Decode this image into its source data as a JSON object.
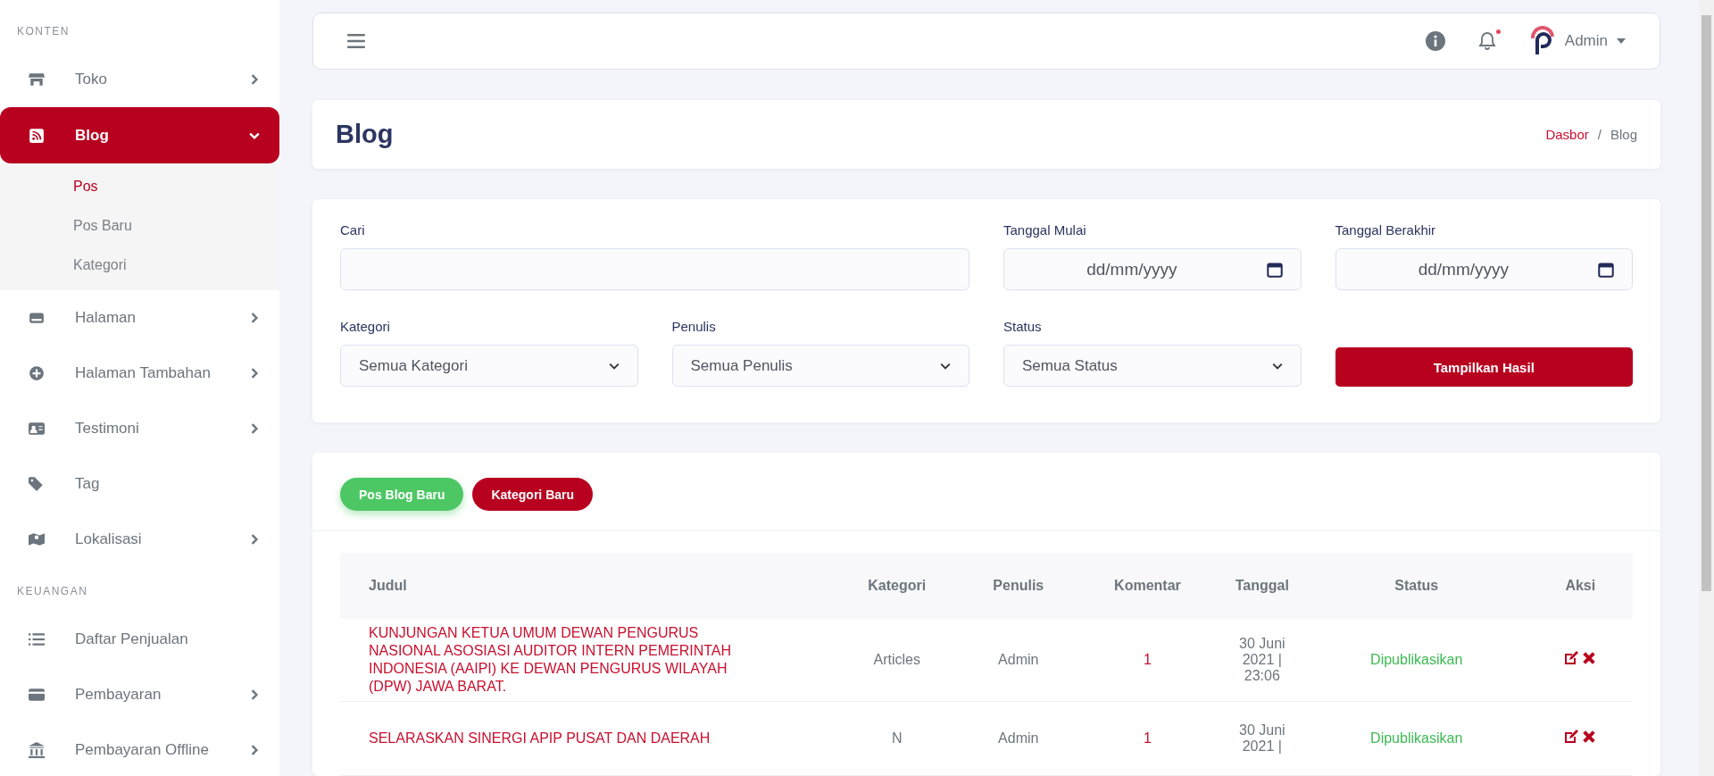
{
  "sidebar": {
    "sections": [
      {
        "heading": "KONTEN",
        "items": [
          {
            "label": "Toko",
            "kind": "group",
            "expanded": false,
            "selected": false
          },
          {
            "label": "Blog",
            "kind": "group",
            "expanded": true,
            "selected": true,
            "children": [
              {
                "label": "Pos",
                "selected": true
              },
              {
                "label": "Pos Baru",
                "selected": false
              },
              {
                "label": "Kategori",
                "selected": false
              }
            ]
          },
          {
            "label": "Halaman",
            "kind": "group",
            "expanded": false,
            "selected": false
          },
          {
            "label": "Halaman Tambahan",
            "kind": "group",
            "expanded": false,
            "selected": false
          },
          {
            "label": "Testimoni",
            "kind": "group",
            "expanded": false,
            "selected": false
          },
          {
            "label": "Tag",
            "kind": "link",
            "expanded": false,
            "selected": false
          },
          {
            "label": "Lokalisasi",
            "kind": "group",
            "expanded": false,
            "selected": false
          }
        ]
      },
      {
        "heading": "KEUANGAN",
        "items": [
          {
            "label": "Daftar Penjualan",
            "kind": "link",
            "expanded": false,
            "selected": false
          },
          {
            "label": "Pembayaran",
            "kind": "group",
            "expanded": false,
            "selected": false
          },
          {
            "label": "Pembayaran Offline",
            "kind": "group",
            "expanded": false,
            "selected": false
          }
        ]
      }
    ]
  },
  "topbar": {
    "user": "Admin",
    "notification_dot": true
  },
  "page_header": {
    "title": "Blog",
    "breadcrumb_separator": "/",
    "breadcrumb": [
      {
        "label": "Dasbor",
        "kind": "link"
      },
      {
        "label": "Blog",
        "kind": "current"
      }
    ]
  },
  "filters": {
    "search": {
      "label": "Cari"
    },
    "start_date": {
      "label": "Tanggal Mulai",
      "placeholder": "dd/mm/yyyy"
    },
    "end_date": {
      "label": "Tanggal Berakhir",
      "placeholder": "dd/mm/yyyy"
    },
    "selects": [
      {
        "label": "Kategori",
        "value": "Semua Kategori"
      },
      {
        "label": "Penulis",
        "value": "Semua Penulis"
      },
      {
        "label": "Status",
        "value": "Semua Status"
      }
    ],
    "submit": "Tampilkan Hasil"
  },
  "actions": [
    {
      "label": "Pos Blog Baru",
      "kind": "success"
    },
    {
      "label": "Kategori Baru",
      "kind": "primary"
    }
  ],
  "table": {
    "columns": [
      "Judul",
      "Kategori",
      "Penulis",
      "Komentar",
      "Tanggal",
      "Status",
      "Aksi"
    ],
    "rows": [
      {
        "title": "KUNJUNGAN KETUA UMUM DEWAN PENGURUS NASIONAL ASOSIASI AUDITOR INTERN PEMERINTAH INDONESIA (AAIPI) KE DEWAN PENGURUS WILAYAH (DPW) JAWA BARAT.",
        "category": "Articles",
        "author": "Admin",
        "comments": "1",
        "date": "30 Juni 2021 | 23:06",
        "status": "Dipublikasikan"
      },
      {
        "title": "SELARASKAN SINERGI APIP PUSAT DAN DAERAH",
        "category": "N",
        "author": "Admin",
        "comments": "1",
        "date": "30 Juni 2021 |",
        "status": "Dipublikasikan"
      }
    ]
  }
}
